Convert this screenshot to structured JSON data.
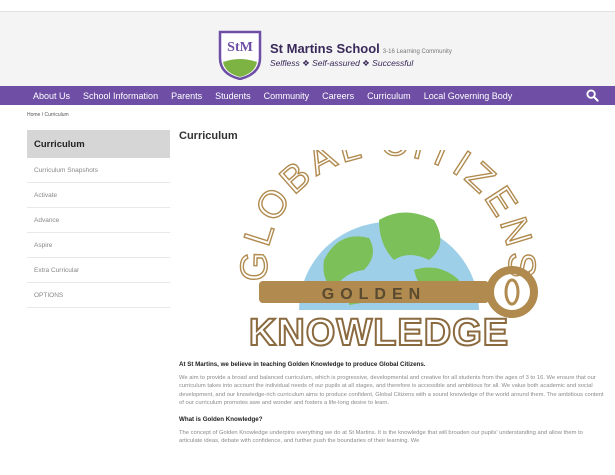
{
  "header": {
    "school_name": "St Martins School",
    "school_sub": "3-16 Learning Community",
    "crest_text": "StM",
    "motto": "Selfless ❖ Self-assured ❖ Successful"
  },
  "nav": {
    "items": [
      "About Us",
      "School Information",
      "Parents",
      "Students",
      "Community",
      "Careers",
      "Curriculum",
      "Local Governing Body"
    ],
    "search_icon": "search-icon"
  },
  "breadcrumb": "Home / Curriculum",
  "sidebar": {
    "title": "Curriculum",
    "items": [
      "Curriculum Snapshots",
      "Activate",
      "Advance",
      "Aspire",
      "Extra Curricular",
      "OPTIONS"
    ]
  },
  "main": {
    "title": "Curriculum",
    "hero": {
      "arc_text": "GLOBAL CITIZENS",
      "key_text": "GOLDEN",
      "big_text": "KNOWLEDGE"
    },
    "lead": "At St Martins, we believe in teaching Golden Knowledge to produce Global Citizens.",
    "para1": "We aim to provide a broad and balanced curriculum, which is progressive, developmental and creative for all students from the ages of 3 to 16. We ensure that our curriculum takes into account the individual needs of our pupils at all stages, and therefore is accessible and ambitious for all. We value both academic and social development, and our knowledge-rich curriculum aims to produce confident, Global Citizens with a sound knowledge of the world around them. The ambitious content of our curriculum promotes awe and wonder and fosters a life-long desire to learn.",
    "question": "What is Golden Knowledge?",
    "para2": "The concept of Golden Knowledge underpins everything we do at St Martins. It is the knowledge that will broaden our pupils' understanding and allow them to articulate ideas, debate with confidence, and further push the boundaries of their learning. We"
  },
  "colors": {
    "nav": "#6e4fa5",
    "brand": "#3a2a5a",
    "gold": "#b08a4e"
  }
}
